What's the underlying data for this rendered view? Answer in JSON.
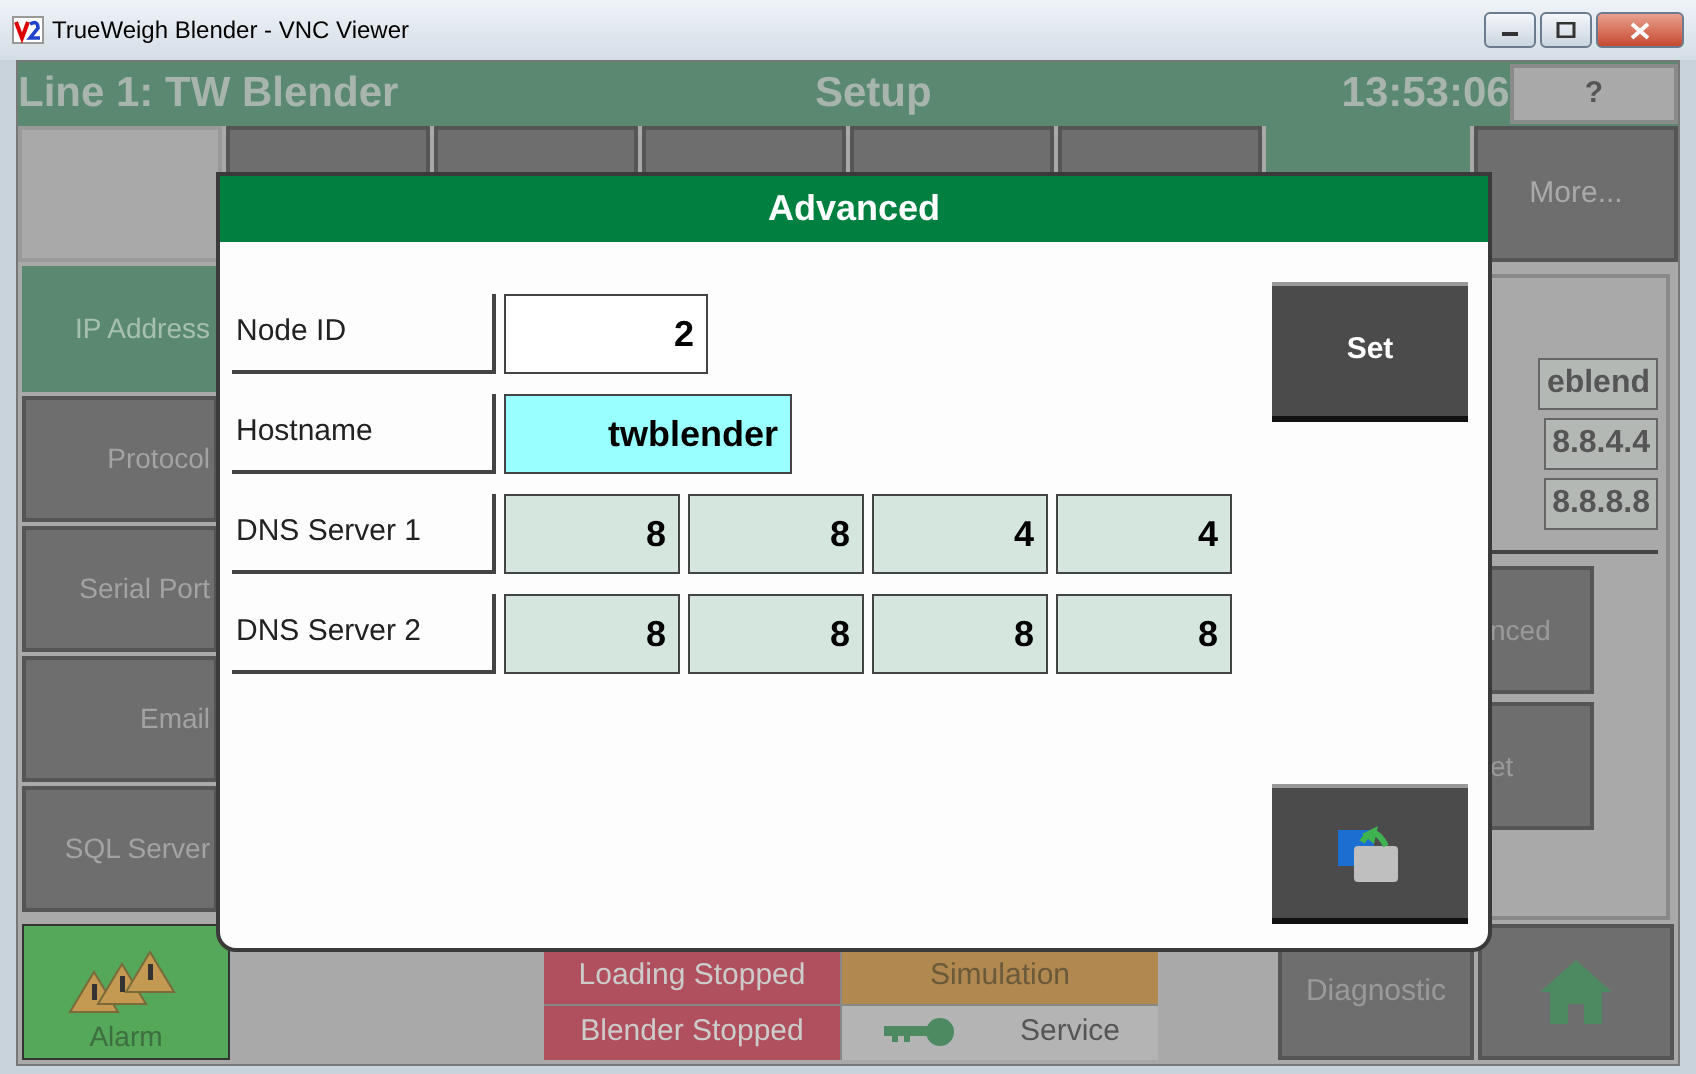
{
  "window": {
    "title": "TrueWeigh Blender - VNC Viewer"
  },
  "header": {
    "line": "Line 1: TW Blender",
    "screen": "Setup",
    "time": "13:53:06",
    "help_button": "?"
  },
  "top_tabs": [
    {
      "selected": false
    },
    {
      "selected": false
    },
    {
      "selected": false
    },
    {
      "selected": false
    },
    {
      "selected": false
    },
    {
      "selected": false
    },
    {
      "selected": true
    },
    {
      "label": "More...",
      "selected": false
    }
  ],
  "sidebar": {
    "items": [
      {
        "label": "IP Address",
        "selected": true
      },
      {
        "label": "Protocol",
        "selected": false
      },
      {
        "label": "Serial Port",
        "selected": false
      },
      {
        "label": "Email",
        "selected": false
      },
      {
        "label": "SQL Server",
        "selected": false
      }
    ]
  },
  "right_panel": {
    "values": [
      "eblend",
      "8.8.4.4",
      "8.8.8.8"
    ],
    "buttons": [
      "nced",
      "et"
    ]
  },
  "dialog": {
    "title": "Advanced",
    "fields": [
      {
        "kind": "single",
        "label": "Node ID",
        "value": "2",
        "highlighted": false
      },
      {
        "kind": "single",
        "label": "Hostname",
        "value": "twblender",
        "highlighted": true
      },
      {
        "kind": "octets",
        "label": "DNS Server 1",
        "values": [
          "8",
          "8",
          "4",
          "4"
        ]
      },
      {
        "kind": "octets",
        "label": "DNS Server 2",
        "values": [
          "8",
          "8",
          "8",
          "8"
        ]
      }
    ],
    "set_button": "Set"
  },
  "status_bar": {
    "alarm": "Alarm",
    "states": [
      {
        "text": "Loading Stopped",
        "color": "#b0505e",
        "kind": "plain"
      },
      {
        "text": "Simulation",
        "color": "#b08850",
        "kind": "plain"
      },
      {
        "text": "Blender Stopped",
        "color": "#b0505e",
        "kind": "plain"
      },
      {
        "text": "Service",
        "color": "#b4b4b4",
        "kind": "key"
      }
    ],
    "diagnostic": "Diagnostic"
  }
}
